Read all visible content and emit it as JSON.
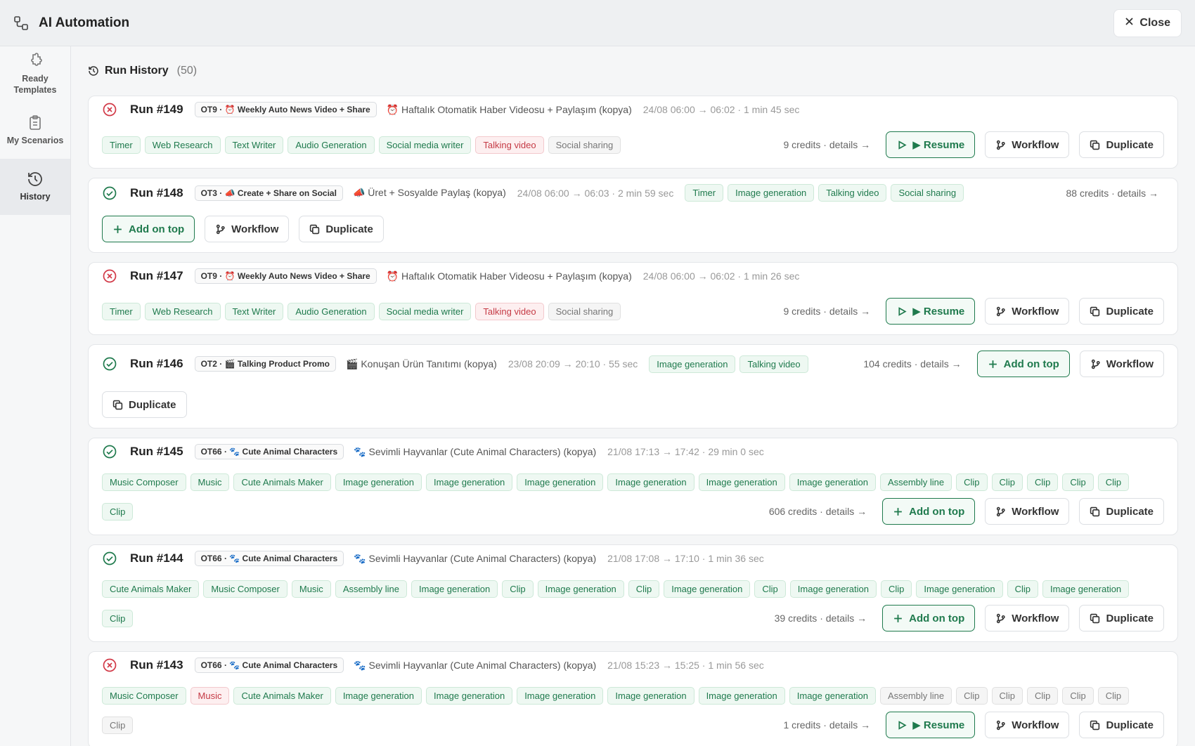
{
  "app": {
    "title": "AI Automation",
    "close_label": "Close"
  },
  "sidebar": {
    "items": [
      {
        "label": "Ready Templates",
        "icon": "puzzle-icon"
      },
      {
        "label": "My Scenarios",
        "icon": "clipboard-icon"
      },
      {
        "label": "History",
        "icon": "history-icon",
        "active": true
      }
    ]
  },
  "history": {
    "title": "Run History",
    "count": "(50)"
  },
  "labels": {
    "resume": "▶ Resume",
    "workflow": "Workflow",
    "duplicate": "Duplicate",
    "add_on_top": "Add on top"
  },
  "runs": [
    {
      "status": "failed",
      "title": "Run #149",
      "template": "OT9 · ⏰ Weekly Auto News Video + Share",
      "scenario": "⏰ Haftalık Otomatik Haber Videosu + Paylaşım (kopya)",
      "time": "24/08 06:00 → 06:02 · 1 min 45 sec",
      "tags": [
        [
          "Timer",
          "ok"
        ],
        [
          "Web Research",
          "ok"
        ],
        [
          "Text Writer",
          "ok"
        ],
        [
          "Audio Generation",
          "ok"
        ],
        [
          "Social media writer",
          "ok"
        ],
        [
          "Talking video",
          "err"
        ],
        [
          "Social sharing",
          "skip"
        ]
      ],
      "credits": "9 credits · details →",
      "primary": "resume"
    },
    {
      "status": "success",
      "title": "Run #148",
      "template": "OT3 · 📣 Create + Share on Social",
      "scenario": "📣 Üret + Sosyalde Paylaş (kopya)",
      "time": "24/08 06:00 → 06:03 · 2 min 59 sec",
      "tags": [
        [
          "Timer",
          "ok"
        ],
        [
          "Image generation",
          "ok"
        ],
        [
          "Talking video",
          "ok"
        ],
        [
          "Social sharing",
          "ok"
        ]
      ],
      "credits": "88 credits · details →",
      "primary": "add"
    },
    {
      "status": "failed",
      "title": "Run #147",
      "template": "OT9 · ⏰ Weekly Auto News Video + Share",
      "scenario": "⏰ Haftalık Otomatik Haber Videosu + Paylaşım (kopya)",
      "time": "24/08 06:00 → 06:02 · 1 min 26 sec",
      "tags": [
        [
          "Timer",
          "ok"
        ],
        [
          "Web Research",
          "ok"
        ],
        [
          "Text Writer",
          "ok"
        ],
        [
          "Audio Generation",
          "ok"
        ],
        [
          "Social media writer",
          "ok"
        ],
        [
          "Talking video",
          "err"
        ],
        [
          "Social sharing",
          "skip"
        ]
      ],
      "credits": "9 credits · details →",
      "primary": "resume"
    },
    {
      "status": "success",
      "title": "Run #146",
      "template": "OT2 · 🎬 Talking Product Promo",
      "scenario": "🎬 Konuşan Ürün Tanıtımı (kopya)",
      "time": "23/08 20:09 → 20:10 · 55 sec",
      "tags": [
        [
          "Image generation",
          "ok"
        ],
        [
          "Talking video",
          "ok"
        ]
      ],
      "credits": "104 credits · details →",
      "primary": "add"
    },
    {
      "status": "success",
      "title": "Run #145",
      "template": "OT66 · 🐾 Cute Animal Characters",
      "scenario": "🐾 Sevimli Hayvanlar (Cute Animal Characters) (kopya)",
      "time": "21/08 17:13 → 17:42 · 29 min 0 sec",
      "tags": [
        [
          "Music Composer",
          "ok"
        ],
        [
          "Music",
          "ok"
        ],
        [
          "Cute Animals Maker",
          "ok"
        ],
        [
          "Image generation",
          "ok"
        ],
        [
          "Image generation",
          "ok"
        ],
        [
          "Image generation",
          "ok"
        ],
        [
          "Image generation",
          "ok"
        ],
        [
          "Image generation",
          "ok"
        ],
        [
          "Image generation",
          "ok"
        ],
        [
          "Assembly line",
          "ok"
        ],
        [
          "Clip",
          "ok"
        ],
        [
          "Clip",
          "ok"
        ],
        [
          "Clip",
          "ok"
        ],
        [
          "Clip",
          "ok"
        ],
        [
          "Clip",
          "ok"
        ],
        [
          "Clip",
          "ok"
        ]
      ],
      "credits": "606 credits · details →",
      "primary": "add"
    },
    {
      "status": "success",
      "title": "Run #144",
      "template": "OT66 · 🐾 Cute Animal Characters",
      "scenario": "🐾 Sevimli Hayvanlar (Cute Animal Characters) (kopya)",
      "time": "21/08 17:08 → 17:10 · 1 min 36 sec",
      "tags": [
        [
          "Cute Animals Maker",
          "ok"
        ],
        [
          "Music Composer",
          "ok"
        ],
        [
          "Music",
          "ok"
        ],
        [
          "Assembly line",
          "ok"
        ],
        [
          "Image generation",
          "ok"
        ],
        [
          "Clip",
          "ok"
        ],
        [
          "Image generation",
          "ok"
        ],
        [
          "Clip",
          "ok"
        ],
        [
          "Image generation",
          "ok"
        ],
        [
          "Clip",
          "ok"
        ],
        [
          "Image generation",
          "ok"
        ],
        [
          "Clip",
          "ok"
        ],
        [
          "Image generation",
          "ok"
        ],
        [
          "Clip",
          "ok"
        ],
        [
          "Image generation",
          "ok"
        ],
        [
          "Clip",
          "ok"
        ]
      ],
      "credits": "39 credits · details →",
      "primary": "add"
    },
    {
      "status": "failed",
      "title": "Run #143",
      "template": "OT66 · 🐾 Cute Animal Characters",
      "scenario": "🐾 Sevimli Hayvanlar (Cute Animal Characters) (kopya)",
      "time": "21/08 15:23 → 15:25 · 1 min 56 sec",
      "tags": [
        [
          "Music Composer",
          "ok"
        ],
        [
          "Music",
          "err"
        ],
        [
          "Cute Animals Maker",
          "ok"
        ],
        [
          "Image generation",
          "ok"
        ],
        [
          "Image generation",
          "ok"
        ],
        [
          "Image generation",
          "ok"
        ],
        [
          "Image generation",
          "ok"
        ],
        [
          "Image generation",
          "ok"
        ],
        [
          "Image generation",
          "ok"
        ],
        [
          "Assembly line",
          "skip"
        ],
        [
          "Clip",
          "skip"
        ],
        [
          "Clip",
          "skip"
        ],
        [
          "Clip",
          "skip"
        ],
        [
          "Clip",
          "skip"
        ],
        [
          "Clip",
          "skip"
        ],
        [
          "Clip",
          "skip"
        ]
      ],
      "credits": "1 credits · details →",
      "primary": "resume"
    }
  ],
  "colors": {
    "success": "#1f7a4d",
    "failed": "#d23a48"
  }
}
